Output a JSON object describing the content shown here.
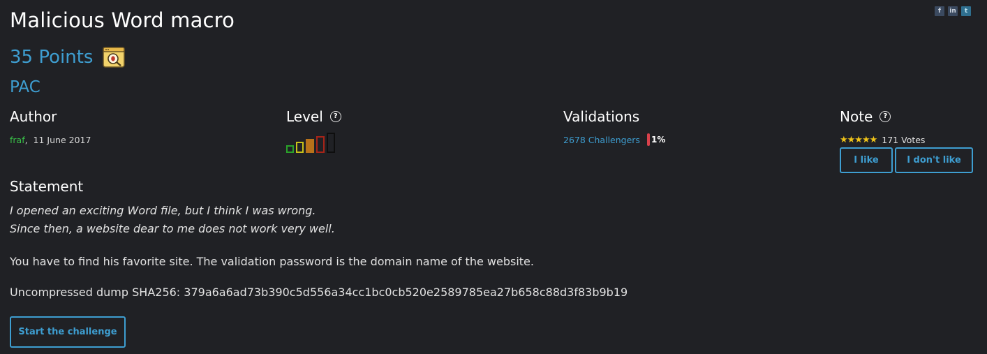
{
  "challenge": {
    "title": "Malicious Word macro",
    "points": "35 Points",
    "category": "PAC"
  },
  "social": {
    "facebook": "f",
    "linkedin": "in",
    "twitter": "t"
  },
  "author": {
    "heading": "Author",
    "name": "fraf",
    "sep": ",",
    "date": "11 June 2017"
  },
  "level": {
    "heading": "Level",
    "help": "?",
    "bars_colors": [
      "#2aa22a",
      "#c8c21a",
      "#b8721a",
      "#a82418",
      "#111111"
    ],
    "current_level": 3
  },
  "validations": {
    "heading": "Validations",
    "challengers": "2678 Challengers",
    "percent": "1%"
  },
  "note": {
    "heading": "Note",
    "help": "?",
    "stars": "★★★★★",
    "votes": "171 Votes",
    "like": "I like",
    "dislike": "I don't like"
  },
  "statement": {
    "heading": "Statement",
    "line1": "I opened an exciting Word file, but I think I was wrong.",
    "line2": "Since then, a website dear to me does not work very well.",
    "p2": "You have to find his favorite site. The validation password is the domain name of the website.",
    "p3": "Uncompressed dump SHA256: 379a6a6ad73b390c5d556a34cc1bc0cb520e2589785ea27b658c88d3f83b9b19"
  },
  "actions": {
    "start": "Start the challenge"
  }
}
